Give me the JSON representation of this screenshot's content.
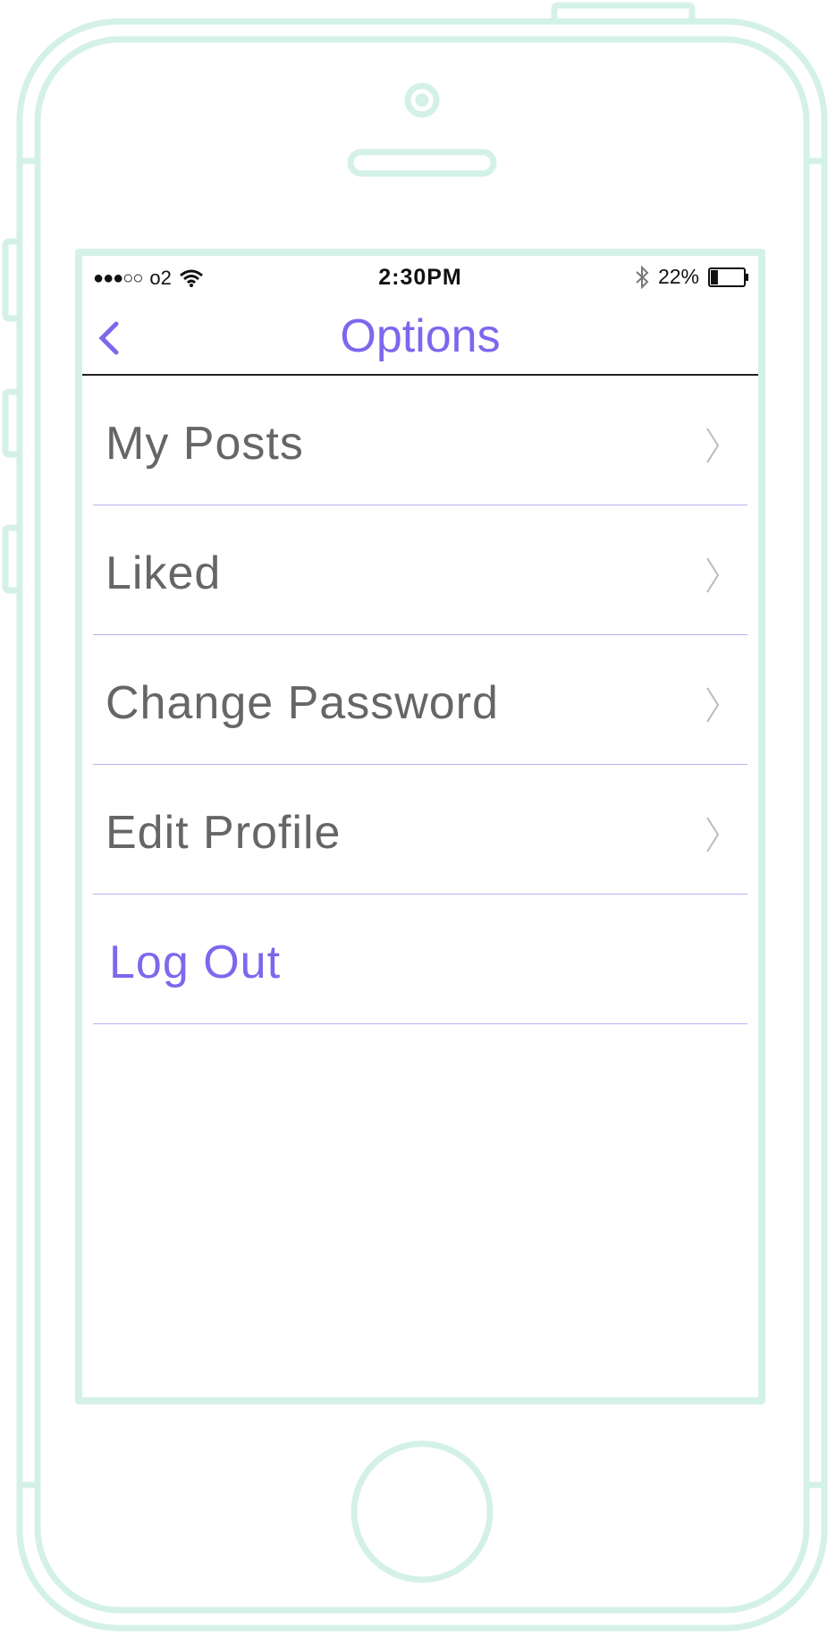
{
  "status_bar": {
    "signal": "●●●○○",
    "carrier": "o2",
    "time": "2:30PM",
    "battery": "22%",
    "battery_level": 0.22
  },
  "nav": {
    "title": "Options",
    "back_icon": "chevron-left-icon"
  },
  "menu": [
    {
      "label": "My Posts",
      "icon": "chevron-right-icon"
    },
    {
      "label": "Liked",
      "icon": "chevron-right-icon"
    },
    {
      "label": "Change Password",
      "icon": "chevron-right-icon"
    },
    {
      "label": "Edit Profile",
      "icon": "chevron-right-icon"
    },
    {
      "label": "Log Out"
    }
  ],
  "colors": {
    "accent": "#7b68ee",
    "frame": "#d4f1e8",
    "divider": "#b9b1f2",
    "text": "#666666"
  }
}
